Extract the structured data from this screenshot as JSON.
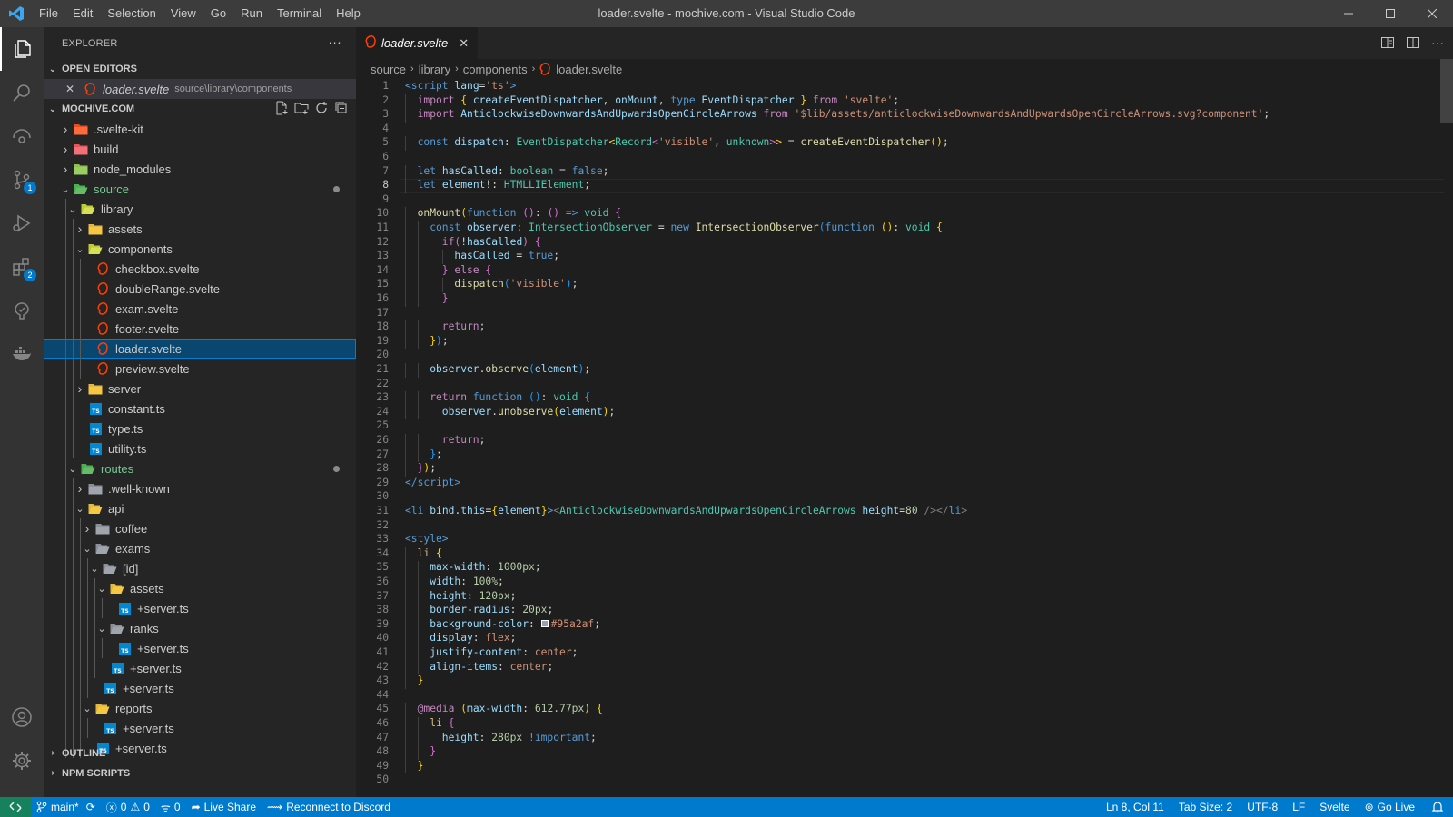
{
  "titlebar": {
    "menu": [
      "File",
      "Edit",
      "Selection",
      "View",
      "Go",
      "Run",
      "Terminal",
      "Help"
    ],
    "title": "loader.svelte - mochive.com - Visual Studio Code"
  },
  "activitybar": {
    "scm_badge": "1",
    "extensions_badge": "2"
  },
  "sidebar": {
    "explorer_title": "EXPLORER",
    "more": "···",
    "open_editors_label": "OPEN EDITORS",
    "open_editor": {
      "name": "loader.svelte",
      "path": "source\\library\\components"
    },
    "workspace_label": "MOCHIVE.COM",
    "tree": [
      {
        "name": ".svelte-kit",
        "depth": 0,
        "type": "folder",
        "icon": "svelte-kit-folder",
        "open": false
      },
      {
        "name": "build",
        "depth": 0,
        "type": "folder",
        "icon": "build-folder",
        "open": false
      },
      {
        "name": "node_modules",
        "depth": 0,
        "type": "folder",
        "icon": "node-folder",
        "open": false
      },
      {
        "name": "source",
        "depth": 0,
        "type": "folder",
        "icon": "src-folder",
        "open": true,
        "modified": true
      },
      {
        "name": "library",
        "depth": 1,
        "type": "folder",
        "icon": "lib-folder",
        "open": true
      },
      {
        "name": "assets",
        "depth": 2,
        "type": "folder",
        "icon": "yellow-folder",
        "open": false
      },
      {
        "name": "components",
        "depth": 2,
        "type": "folder",
        "icon": "components-folder",
        "open": true
      },
      {
        "name": "checkbox.svelte",
        "depth": 3,
        "type": "svelte"
      },
      {
        "name": "doubleRange.svelte",
        "depth": 3,
        "type": "svelte"
      },
      {
        "name": "exam.svelte",
        "depth": 3,
        "type": "svelte"
      },
      {
        "name": "footer.svelte",
        "depth": 3,
        "type": "svelte"
      },
      {
        "name": "loader.svelte",
        "depth": 3,
        "type": "svelte",
        "selected": true
      },
      {
        "name": "preview.svelte",
        "depth": 3,
        "type": "svelte"
      },
      {
        "name": "server",
        "depth": 2,
        "type": "folder",
        "icon": "yellow-folder",
        "open": false
      },
      {
        "name": "constant.ts",
        "depth": 2,
        "type": "ts"
      },
      {
        "name": "type.ts",
        "depth": 2,
        "type": "ts"
      },
      {
        "name": "utility.ts",
        "depth": 2,
        "type": "ts"
      },
      {
        "name": "routes",
        "depth": 1,
        "type": "folder",
        "icon": "routes-folder",
        "open": true,
        "modified": true
      },
      {
        "name": ".well-known",
        "depth": 2,
        "type": "folder",
        "icon": "grey-folder",
        "open": false
      },
      {
        "name": "api",
        "depth": 2,
        "type": "folder",
        "icon": "api-folder",
        "open": true
      },
      {
        "name": "coffee",
        "depth": 3,
        "type": "folder",
        "icon": "grey-folder",
        "open": false
      },
      {
        "name": "exams",
        "depth": 3,
        "type": "folder",
        "icon": "grey-folder",
        "open": true
      },
      {
        "name": "[id]",
        "depth": 4,
        "type": "folder",
        "icon": "grey-folder",
        "open": true
      },
      {
        "name": "assets",
        "depth": 5,
        "type": "folder",
        "icon": "yellow-folder",
        "open": true
      },
      {
        "name": "+server.ts",
        "depth": 6,
        "type": "ts"
      },
      {
        "name": "ranks",
        "depth": 5,
        "type": "folder",
        "icon": "grey-folder",
        "open": true
      },
      {
        "name": "+server.ts",
        "depth": 6,
        "type": "ts"
      },
      {
        "name": "+server.ts",
        "depth": 5,
        "type": "ts"
      },
      {
        "name": "+server.ts",
        "depth": 4,
        "type": "ts"
      },
      {
        "name": "reports",
        "depth": 3,
        "type": "folder",
        "icon": "yellow-folder",
        "open": true
      },
      {
        "name": "+server.ts",
        "depth": 4,
        "type": "ts"
      },
      {
        "name": "+server.ts",
        "depth": 3,
        "type": "ts"
      }
    ],
    "outline_label": "OUTLINE",
    "npm_label": "NPM SCRIPTS"
  },
  "editor": {
    "tab_label": "loader.svelte",
    "tab_close": "✕",
    "breadcrumbs": [
      "source",
      "library",
      "components",
      "loader.svelte"
    ],
    "current_line": 8,
    "lines": [
      [
        [
          "tg",
          "<script "
        ],
        [
          "v",
          "lang"
        ],
        [
          "",
          "="
        ],
        [
          "s",
          "'ts'"
        ],
        [
          "tg",
          ">"
        ]
      ],
      [
        [
          "",
          ""
        ],
        [
          "kc",
          "import "
        ],
        [
          "b1",
          "{ "
        ],
        [
          "v",
          "createEventDispatcher"
        ],
        [
          "",
          ", "
        ],
        [
          "v",
          "onMount"
        ],
        [
          "",
          ", "
        ],
        [
          "k",
          "type "
        ],
        [
          "v",
          "EventDispatcher"
        ],
        [
          "b1",
          " } "
        ],
        [
          "kc",
          "from "
        ],
        [
          "s",
          "'svelte'"
        ],
        [
          "",
          ";"
        ]
      ],
      [
        [
          "",
          ""
        ],
        [
          "kc",
          "import "
        ],
        [
          "v",
          "AnticlockwiseDownwardsAndUpwardsOpenCircleArrows "
        ],
        [
          "kc",
          "from "
        ],
        [
          "s",
          "'$lib/assets/anticlockwiseDownwardsAndUpwardsOpenCircleArrows.svg?component'"
        ],
        [
          "",
          ";"
        ]
      ],
      [],
      [
        [
          "",
          ""
        ],
        [
          "k",
          "const "
        ],
        [
          "v",
          "dispatch"
        ],
        [
          "",
          ": "
        ],
        [
          "t",
          "EventDispatcher"
        ],
        [
          "b1",
          "<"
        ],
        [
          "t",
          "Record"
        ],
        [
          "b2",
          "<"
        ],
        [
          "s",
          "'visible'"
        ],
        [
          "",
          ", "
        ],
        [
          "t",
          "unknown"
        ],
        [
          "b2",
          ">"
        ],
        [
          "b1",
          ">"
        ],
        [
          "",
          " = "
        ],
        [
          "f",
          "createEventDispatcher"
        ],
        [
          "b1",
          "()"
        ],
        [
          "",
          ";"
        ]
      ],
      [],
      [
        [
          "",
          ""
        ],
        [
          "k",
          "let "
        ],
        [
          "v",
          "hasCalled"
        ],
        [
          "",
          ": "
        ],
        [
          "t",
          "boolean"
        ],
        [
          "",
          " = "
        ],
        [
          "k",
          "false"
        ],
        [
          "",
          ";"
        ]
      ],
      [
        [
          "",
          ""
        ],
        [
          "k",
          "let "
        ],
        [
          "v",
          "element"
        ],
        [
          "",
          "!: "
        ],
        [
          "t",
          "HTMLLIElement"
        ],
        [
          "",
          ";"
        ]
      ],
      [],
      [
        [
          "",
          ""
        ],
        [
          "f",
          "onMount"
        ],
        [
          "b1",
          "("
        ],
        [
          "k",
          "function "
        ],
        [
          "b2",
          "()"
        ],
        [
          "",
          ": "
        ],
        [
          "b2",
          "() "
        ],
        [
          "k",
          "=> "
        ],
        [
          "t",
          "void "
        ],
        [
          "b2",
          "{"
        ]
      ],
      [
        [
          "",
          ""
        ],
        [
          "k",
          "const "
        ],
        [
          "v",
          "observer"
        ],
        [
          "",
          ": "
        ],
        [
          "t",
          "IntersectionObserver"
        ],
        [
          "",
          " = "
        ],
        [
          "k",
          "new "
        ],
        [
          "f",
          "IntersectionObserver"
        ],
        [
          "b3",
          "("
        ],
        [
          "k",
          "function "
        ],
        [
          "b1",
          "()"
        ],
        [
          "",
          ": "
        ],
        [
          "t",
          "void "
        ],
        [
          "b1",
          "{"
        ]
      ],
      [
        [
          "",
          ""
        ],
        [
          "kc",
          "if"
        ],
        [
          "b2",
          "("
        ],
        [
          "",
          "!"
        ],
        [
          "v",
          "hasCalled"
        ],
        [
          "b2",
          ") "
        ],
        [
          "b2",
          "{"
        ]
      ],
      [
        [
          "",
          ""
        ],
        [
          "v",
          "hasCalled"
        ],
        [
          "",
          " = "
        ],
        [
          "k",
          "true"
        ],
        [
          "",
          ";"
        ]
      ],
      [
        [
          "",
          ""
        ],
        [
          "b2",
          "} "
        ],
        [
          "kc",
          "else "
        ],
        [
          "b2",
          "{"
        ]
      ],
      [
        [
          "",
          ""
        ],
        [
          "f",
          "dispatch"
        ],
        [
          "b3",
          "("
        ],
        [
          "s",
          "'visible'"
        ],
        [
          "b3",
          ")"
        ],
        [
          "",
          ";"
        ]
      ],
      [
        [
          "",
          ""
        ],
        [
          "b2",
          "}"
        ]
      ],
      [],
      [
        [
          "",
          ""
        ],
        [
          "kc",
          "return"
        ],
        [
          "",
          ";"
        ]
      ],
      [
        [
          "",
          ""
        ],
        [
          "b1",
          "}"
        ],
        [
          "b3",
          ")"
        ],
        [
          "",
          ";"
        ]
      ],
      [],
      [
        [
          "",
          ""
        ],
        [
          "v",
          "observer"
        ],
        [
          "",
          "."
        ],
        [
          "f",
          "observe"
        ],
        [
          "b3",
          "("
        ],
        [
          "v",
          "element"
        ],
        [
          "b3",
          ")"
        ],
        [
          "",
          ";"
        ]
      ],
      [],
      [
        [
          "",
          ""
        ],
        [
          "kc",
          "return "
        ],
        [
          "k",
          "function "
        ],
        [
          "b3",
          "()"
        ],
        [
          "",
          ": "
        ],
        [
          "t",
          "void "
        ],
        [
          "b3",
          "{"
        ]
      ],
      [
        [
          "",
          ""
        ],
        [
          "v",
          "observer"
        ],
        [
          "",
          "."
        ],
        [
          "f",
          "unobserve"
        ],
        [
          "b1",
          "("
        ],
        [
          "v",
          "element"
        ],
        [
          "b1",
          ")"
        ],
        [
          "",
          ";"
        ]
      ],
      [],
      [
        [
          "",
          ""
        ],
        [
          "kc",
          "return"
        ],
        [
          "",
          ";"
        ]
      ],
      [
        [
          "",
          ""
        ],
        [
          "b3",
          "}"
        ],
        [
          "",
          ";"
        ]
      ],
      [
        [
          "",
          ""
        ],
        [
          "b2",
          "}"
        ],
        [
          "b1",
          ")"
        ],
        [
          "",
          ";"
        ]
      ],
      [
        [
          "tg",
          "</"
        ],
        [
          "tg",
          "script"
        ],
        [
          "tg",
          ">"
        ]
      ],
      [],
      [
        [
          "tg",
          "<li "
        ],
        [
          "v",
          "bind"
        ],
        [
          "",
          "."
        ],
        [
          "v",
          "this"
        ],
        [
          "",
          "="
        ],
        [
          "b1",
          "{"
        ],
        [
          "v",
          "element"
        ],
        [
          "b1",
          "}"
        ],
        [
          "tg",
          ">"
        ],
        [
          "tb",
          "<"
        ],
        [
          "t",
          "AnticlockwiseDownwardsAndUpwardsOpenCircleArrows "
        ],
        [
          "v",
          "height"
        ],
        [
          "",
          "="
        ],
        [
          "n",
          "80"
        ],
        [
          "tb",
          " />"
        ],
        [
          "tb",
          "</"
        ],
        [
          "tg",
          "li"
        ],
        [
          "tb",
          ">"
        ]
      ],
      [],
      [
        [
          "tg",
          "<style>"
        ]
      ],
      [
        [
          "",
          ""
        ],
        [
          "sel",
          "li "
        ],
        [
          "b1",
          "{"
        ]
      ],
      [
        [
          "",
          ""
        ],
        [
          "pr",
          "max-width"
        ],
        [
          "",
          ": "
        ],
        [
          "n",
          "1000px"
        ],
        [
          "",
          ";"
        ]
      ],
      [
        [
          "",
          ""
        ],
        [
          "pr",
          "width"
        ],
        [
          "",
          ": "
        ],
        [
          "n",
          "100%"
        ],
        [
          "",
          ";"
        ]
      ],
      [
        [
          "",
          ""
        ],
        [
          "pr",
          "height"
        ],
        [
          "",
          ": "
        ],
        [
          "n",
          "120px"
        ],
        [
          "",
          ";"
        ]
      ],
      [
        [
          "",
          ""
        ],
        [
          "pr",
          "border-radius"
        ],
        [
          "",
          ": "
        ],
        [
          "n",
          "20px"
        ],
        [
          "",
          ";"
        ]
      ],
      [
        [
          "",
          ""
        ],
        [
          "pr",
          "background-color"
        ],
        [
          "",
          ": "
        ],
        [
          "swatch",
          ""
        ],
        [
          "s",
          "#95a2af"
        ],
        [
          "",
          ";"
        ]
      ],
      [
        [
          "",
          ""
        ],
        [
          "pr",
          "display"
        ],
        [
          "",
          ": "
        ],
        [
          "s",
          "flex"
        ],
        [
          "",
          ";"
        ]
      ],
      [
        [
          "",
          ""
        ],
        [
          "pr",
          "justify-content"
        ],
        [
          "",
          ": "
        ],
        [
          "s",
          "center"
        ],
        [
          "",
          ";"
        ]
      ],
      [
        [
          "",
          ""
        ],
        [
          "pr",
          "align-items"
        ],
        [
          "",
          ": "
        ],
        [
          "s",
          "center"
        ],
        [
          "",
          ";"
        ]
      ],
      [
        [
          "",
          ""
        ],
        [
          "b1",
          "}"
        ]
      ],
      [],
      [
        [
          "",
          ""
        ],
        [
          "kc",
          "@media "
        ],
        [
          "b1",
          "("
        ],
        [
          "pr",
          "max-width"
        ],
        [
          "",
          ": "
        ],
        [
          "n",
          "612.77px"
        ],
        [
          "b1",
          ") "
        ],
        [
          "b1",
          "{"
        ]
      ],
      [
        [
          "",
          ""
        ],
        [
          "sel",
          "li "
        ],
        [
          "b2",
          "{"
        ]
      ],
      [
        [
          "",
          ""
        ],
        [
          "pr",
          "height"
        ],
        [
          "",
          ": "
        ],
        [
          "n",
          "280px "
        ],
        [
          "k",
          "!important"
        ],
        [
          "",
          ";"
        ]
      ],
      [
        [
          "",
          ""
        ],
        [
          "b2",
          "}"
        ]
      ],
      [
        [
          "",
          ""
        ],
        [
          "b1",
          "}"
        ]
      ],
      []
    ],
    "indents": [
      0,
      1,
      1,
      0,
      1,
      0,
      1,
      1,
      0,
      1,
      2,
      3,
      4,
      3,
      4,
      3,
      0,
      3,
      2,
      0,
      2,
      0,
      2,
      3,
      0,
      3,
      2,
      1,
      0,
      0,
      0,
      0,
      0,
      1,
      2,
      2,
      2,
      2,
      2,
      2,
      2,
      2,
      1,
      0,
      1,
      2,
      3,
      2,
      1,
      0
    ],
    "swatch_color": "#95a2af"
  },
  "statusbar": {
    "branch": "main*",
    "errors": "0",
    "warnings": "0",
    "ports": "0",
    "live_share": "Live Share",
    "discord": "Reconnect to Discord",
    "position": "Ln 8, Col 11",
    "tab_size": "Tab Size: 2",
    "encoding": "UTF-8",
    "eol": "LF",
    "language": "Svelte",
    "go_live": "Go Live"
  }
}
